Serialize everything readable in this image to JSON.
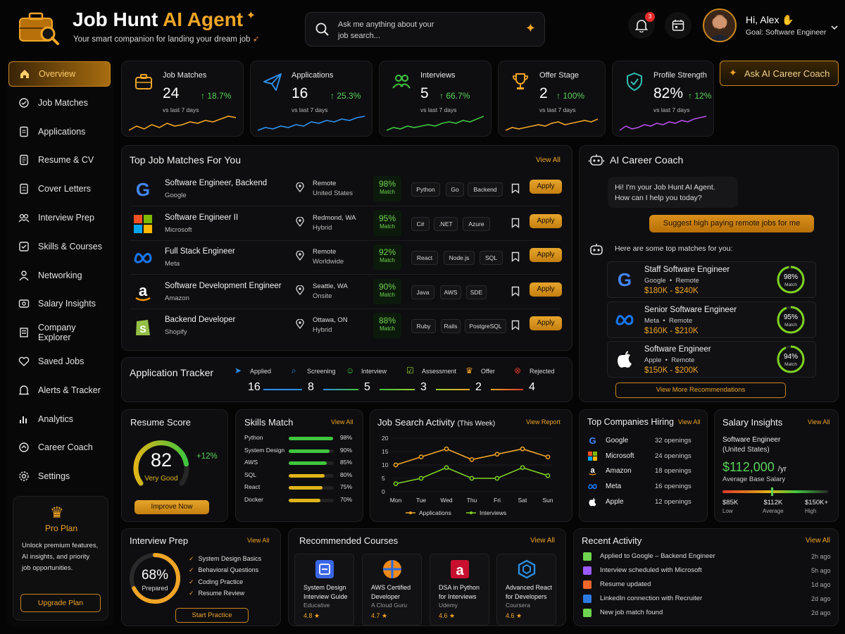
{
  "header": {
    "title_a": "Job Hunt ",
    "title_b": "AI Agent",
    "subtitle": "Your smart companion for landing your dream job",
    "search_placeholder_1": "Ask me anything about your",
    "search_placeholder_2": "job search...",
    "notif_count": "3",
    "greeting": "Hi, Alex",
    "goal": "Goal: Software Engineer"
  },
  "sidebar": {
    "items": [
      "Overview",
      "Job Matches",
      "Applications",
      "Resume & CV",
      "Cover Letters",
      "Interview Prep",
      "Skills & Courses",
      "Networking",
      "Salary Insights",
      "Company Explorer",
      "Saved Jobs",
      "Alerts & Tracker",
      "Analytics",
      "Career Coach",
      "Settings"
    ],
    "pro": {
      "title": "Pro Plan",
      "text1": "Unlock premium features,",
      "text2": "AI insights, and priority",
      "text3": "job opportunities.",
      "button": "Upgrade Plan"
    }
  },
  "stats": [
    {
      "label": "Job Matches",
      "value": "24",
      "pct": "18.7%",
      "sub": "vs last 7 days"
    },
    {
      "label": "Applications",
      "value": "16",
      "pct": "25.3%",
      "sub": "vs last 7 days"
    },
    {
      "label": "Interviews",
      "value": "5",
      "pct": "66.7%",
      "sub": "vs last 7 days"
    },
    {
      "label": "Offer Stage",
      "value": "2",
      "pct": "100%",
      "sub": "vs last 7 days"
    },
    {
      "label": "Profile Strength",
      "value": "82%",
      "pct": "12%",
      "sub": "vs last 7 days"
    }
  ],
  "coach_button": "Ask AI Career Coach",
  "top_matches": {
    "title": "Top Job Matches For You",
    "view_all": "View All",
    "match_label": "Match",
    "apply": "Apply",
    "jobs": [
      {
        "title": "Software Engineer, Backend",
        "company": "Google",
        "loc1": "Remote",
        "loc2": "United States",
        "match": "98%",
        "tags": [
          "Python",
          "Go",
          "Backend"
        ]
      },
      {
        "title": "Software Engineer II",
        "company": "Microsoft",
        "loc1": "Redmond, WA",
        "loc2": "Hybrid",
        "match": "95%",
        "tags": [
          "C#",
          ".NET",
          "Azure"
        ]
      },
      {
        "title": "Full Stack Engineer",
        "company": "Meta",
        "loc1": "Remote",
        "loc2": "Worldwide",
        "match": "92%",
        "tags": [
          "React",
          "Node.js",
          "SQL"
        ]
      },
      {
        "title": "Software Development Engineer",
        "company": "Amazon",
        "loc1": "Seattle, WA",
        "loc2": "Onsite",
        "match": "90%",
        "tags": [
          "Java",
          "AWS",
          "SDE"
        ]
      },
      {
        "title": "Backend Developer",
        "company": "Shopify",
        "loc1": "Ottawa, ON",
        "loc2": "Hybrid",
        "match": "88%",
        "tags": [
          "Ruby",
          "Rails",
          "PostgreSQL"
        ]
      }
    ]
  },
  "tracker": {
    "title": "Application Tracker",
    "stages": [
      {
        "label": "Applied",
        "value": "16"
      },
      {
        "label": "Screening",
        "value": "8"
      },
      {
        "label": "Interview",
        "value": "5"
      },
      {
        "label": "Assessment",
        "value": "3"
      },
      {
        "label": "Offer",
        "value": "2"
      },
      {
        "label": "Rejected",
        "value": "4"
      }
    ]
  },
  "coach": {
    "title": "AI Career Coach",
    "bot_msg1": "Hi! I'm your Job Hunt AI Agent.",
    "bot_msg2": "How can I help you today?",
    "user_msg": "Suggest high paying remote jobs for me",
    "bot_msg3": "Here are some top matches for you:",
    "match_label": "Match",
    "recs": [
      {
        "title": "Staff Software Engineer",
        "company": "Google",
        "mode": "Remote",
        "salary": "$180K - $240K",
        "match": "98%",
        "pct": 98
      },
      {
        "title": "Senior Software Engineer",
        "company": "Meta",
        "mode": "Remote",
        "salary": "$160K - $210K",
        "match": "95%",
        "pct": 95
      },
      {
        "title": "Software Engineer",
        "company": "Apple",
        "mode": "Remote",
        "salary": "$150K - $200K",
        "match": "94%",
        "pct": 94
      }
    ],
    "view_more": "View More Recommendations"
  },
  "resume": {
    "title": "Resume Score",
    "score": "82",
    "score_value": 82,
    "label": "Very Good",
    "delta": "+12%",
    "button": "Improve Now"
  },
  "skills": {
    "title": "Skills Match",
    "view_all": "View All",
    "items": [
      {
        "name": "Python",
        "value": "98%",
        "pct": 98,
        "color": "#3fc63f"
      },
      {
        "name": "System Design",
        "value": "90%",
        "pct": 90,
        "color": "#3fc63f"
      },
      {
        "name": "AWS",
        "value": "85%",
        "pct": 85,
        "color": "#3fc63f"
      },
      {
        "name": "SQL",
        "value": "80%",
        "pct": 80,
        "color": "#e0b418"
      },
      {
        "name": "React",
        "value": "75%",
        "pct": 75,
        "color": "#e0b418"
      },
      {
        "name": "Docker",
        "value": "70%",
        "pct": 70,
        "color": "#e0b418"
      }
    ]
  },
  "activity": {
    "title": "Job Search Activity",
    "period": "(This Week)",
    "view": "View Report"
  },
  "chart_data": {
    "type": "line",
    "categories": [
      "Mon",
      "Tue",
      "Wed",
      "Thu",
      "Fri",
      "Sat",
      "Sun"
    ],
    "series": [
      {
        "name": "Applications",
        "values": [
          10,
          13,
          16,
          12,
          14,
          16,
          13
        ],
        "color": "#f0a526"
      },
      {
        "name": "Interviews",
        "values": [
          3,
          5,
          9,
          5,
          5,
          9,
          6
        ],
        "color": "#7ed321"
      }
    ],
    "ylim": [
      0,
      20
    ],
    "yticks": [
      0,
      5,
      10,
      15,
      20
    ],
    "title": "Job Search Activity",
    "legend": "bottom"
  },
  "companies": {
    "title": "Top Companies Hiring",
    "view_all": "View All",
    "items": [
      {
        "name": "Google",
        "openings": "32 openings"
      },
      {
        "name": "Microsoft",
        "openings": "24 openings"
      },
      {
        "name": "Amazon",
        "openings": "18 openings"
      },
      {
        "name": "Meta",
        "openings": "16 openings"
      },
      {
        "name": "Apple",
        "openings": "12 openings"
      }
    ]
  },
  "salary": {
    "title": "Salary Insights",
    "view_all": "View All",
    "role": "Software Engineer",
    "country": "(United States)",
    "value": "$112,000",
    "unit": "/yr",
    "caption": "Average Base Salary",
    "low": "$85K",
    "low_lbl": "Low",
    "avg": "$112K",
    "avg_lbl": "Average",
    "high": "$150K+",
    "high_lbl": "High"
  },
  "interview": {
    "title": "Interview Prep",
    "view_all": "View All",
    "pct": "68%",
    "pct_value": 68,
    "prepared": "Prepared",
    "items": [
      "System Design Basics",
      "Behavioral Questions",
      "Coding Practice",
      "Resume Review"
    ],
    "button": "Start Practice"
  },
  "courses": {
    "title": "Recommended Courses",
    "view_all": "View All",
    "items": [
      {
        "t1": "System Design",
        "t2": "Interview Guide",
        "provider": "Educative",
        "rating": "4.8 ★"
      },
      {
        "t1": "AWS Certified",
        "t2": "Developer",
        "provider": "A Cloud Guru",
        "rating": "4.7 ★"
      },
      {
        "t1": "DSA in Python",
        "t2": "for Interviews",
        "provider": "Udemy",
        "rating": "4.6 ★"
      },
      {
        "t1": "Advanced React",
        "t2": "for Developers",
        "provider": "Coursera",
        "rating": "4.6 ★"
      }
    ]
  },
  "recent": {
    "title": "Recent Activity",
    "view_all": "View All",
    "items": [
      {
        "text": "Applied to Google – Backend Engineer",
        "time": "2h ago",
        "color": "#6fd44f"
      },
      {
        "text": "Interview scheduled with Microsoft",
        "time": "5h ago",
        "color": "#9b59ff"
      },
      {
        "text": "Resume updated",
        "time": "1d ago",
        "color": "#f2662a"
      },
      {
        "text": "LinkedIn connection with Recruiter",
        "time": "2d ago",
        "color": "#2d7be0"
      },
      {
        "text": "New job match found",
        "time": "2d ago",
        "color": "#6fd44f"
      }
    ]
  }
}
